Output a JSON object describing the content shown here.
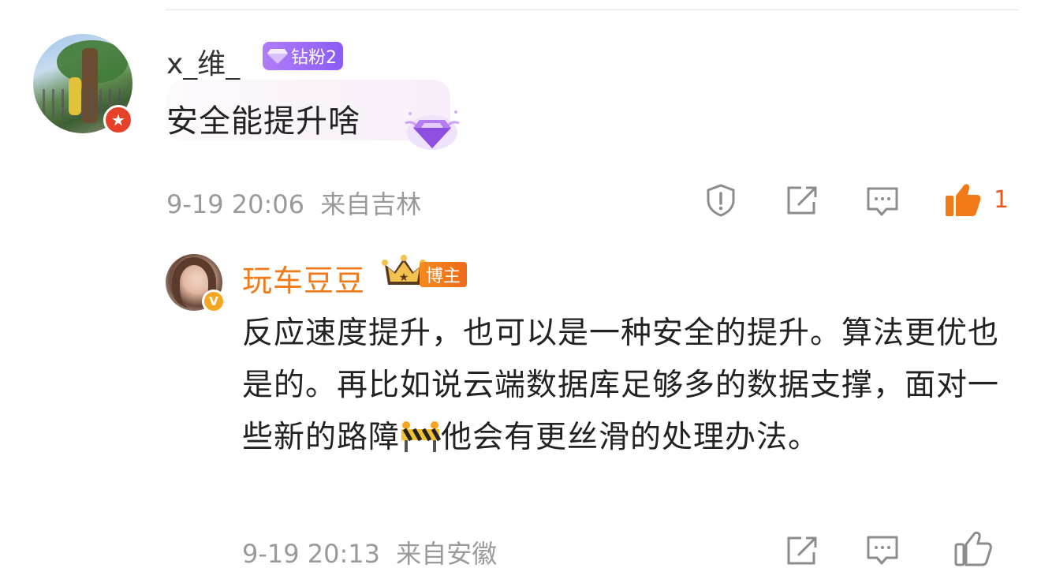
{
  "comment": {
    "username": "x_维_",
    "fan_badge": "钻粉2",
    "text": "安全能提升啥",
    "time": "9-19 20:06",
    "location": "来自吉林",
    "like_count": "1"
  },
  "reply": {
    "username": "玩车豆豆",
    "role_badge": "博主",
    "text_before": "反应速度提升，也可以是一种安全的提升。算法更优也是的。再比如说云端数据库足够多的数据支撑，面对一些新的路障",
    "text_after": "他会有更丝滑的处理办法。",
    "time": "9-19 20:13",
    "location": "来自安徽"
  },
  "colors": {
    "username_reply": "#f07a18",
    "meta_gray": "#9a9a9a",
    "like_orange": "#ea5a1f",
    "fan_badge_purple": "#8b5cf6"
  },
  "icons": [
    "report-icon",
    "share-icon",
    "comment-icon",
    "like-icon",
    "verified-v-icon",
    "crown-icon",
    "diamond-icon",
    "roadblock-emoji"
  ]
}
